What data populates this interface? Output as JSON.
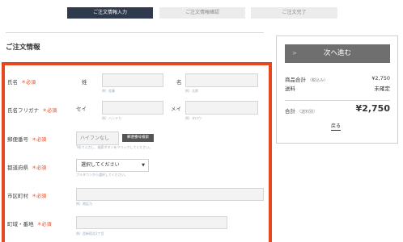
{
  "steps": [
    "ご注文情報入力",
    "ご注文情報確認",
    "ご注文完了"
  ],
  "section_title": "ご注文情報",
  "required_label": "＊必須",
  "form": {
    "name": {
      "label": "氏名",
      "last_label": "姓",
      "first_label": "名",
      "last_hint": "例）佐藤",
      "first_hint": "例）太郎"
    },
    "kana": {
      "label": "氏名フリガナ",
      "last_label": "セイ",
      "first_label": "メイ",
      "last_hint": "例）ハンドカ",
      "first_hint": "例）タロウ"
    },
    "postal": {
      "label": "郵便番号",
      "placeholder": "ハイフンなし",
      "search_button": "郵便番号検索",
      "hint": "7桁で入力し、検索ボタンをクリックしてください。"
    },
    "prefecture": {
      "label": "都道府県",
      "selected": "選択してください",
      "hint": "プルダウンから選択してください。"
    },
    "city": {
      "label": "市区町村",
      "hint": "例）港区乃"
    },
    "street": {
      "label": "町域・番地",
      "hint": "例）西新宿北2丁目"
    }
  },
  "summary": {
    "next_button": "次へ進む",
    "subtotal_label": "商品合計",
    "subtotal_note": "（税込み）",
    "subtotal_value": "¥2,750",
    "shipping_label": "送料",
    "shipping_value": "未確定",
    "total_label": "合計",
    "total_note": "（送料別）",
    "total_value": "¥2,750",
    "back_link": "戻る"
  }
}
